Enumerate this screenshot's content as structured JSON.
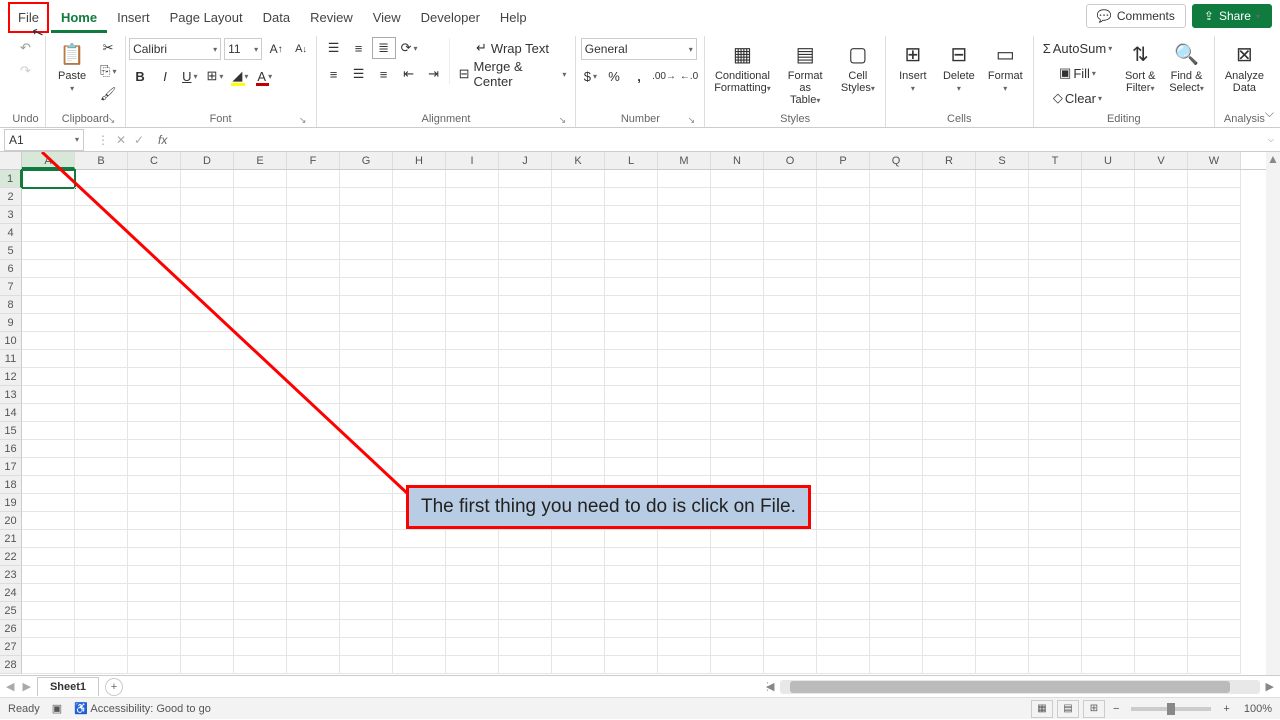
{
  "tabs": {
    "file": "File",
    "home": "Home",
    "insert": "Insert",
    "page_layout": "Page Layout",
    "data": "Data",
    "review": "Review",
    "view": "View",
    "developer": "Developer",
    "help": "Help"
  },
  "top_right": {
    "comments": "Comments",
    "share": "Share"
  },
  "ribbon": {
    "undo": {
      "label": "Undo"
    },
    "clipboard": {
      "paste": "Paste",
      "label": "Clipboard"
    },
    "font": {
      "name": "Calibri",
      "size": "11",
      "label": "Font"
    },
    "alignment": {
      "wrap": "Wrap Text",
      "merge": "Merge & Center",
      "label": "Alignment"
    },
    "number": {
      "format": "General",
      "label": "Number"
    },
    "styles": {
      "conditional": "Conditional Formatting",
      "format_table": "Format as Table",
      "cell_styles": "Cell Styles",
      "label": "Styles"
    },
    "cells": {
      "insert": "Insert",
      "delete": "Delete",
      "format": "Format",
      "label": "Cells"
    },
    "editing": {
      "autosum": "AutoSum",
      "fill": "Fill",
      "clear": "Clear",
      "sort": "Sort & Filter",
      "find": "Find & Select",
      "label": "Editing"
    },
    "analysis": {
      "analyze": "Analyze Data",
      "label": "Analysis"
    }
  },
  "namebox": "A1",
  "columns": [
    "A",
    "B",
    "C",
    "D",
    "E",
    "F",
    "G",
    "H",
    "I",
    "J",
    "K",
    "L",
    "M",
    "N",
    "O",
    "P",
    "Q",
    "R",
    "S",
    "T",
    "U",
    "V",
    "W"
  ],
  "rows": [
    1,
    2,
    3,
    4,
    5,
    6,
    7,
    8,
    9,
    10,
    11,
    12,
    13,
    14,
    15,
    16,
    17,
    18,
    19,
    20,
    21,
    22,
    23,
    24,
    25,
    26,
    27,
    28
  ],
  "callout_text": "The first thing you need to do is click on File.",
  "sheet": {
    "name": "Sheet1"
  },
  "status": {
    "ready": "Ready",
    "accessibility": "Accessibility: Good to go",
    "zoom": "100%"
  }
}
